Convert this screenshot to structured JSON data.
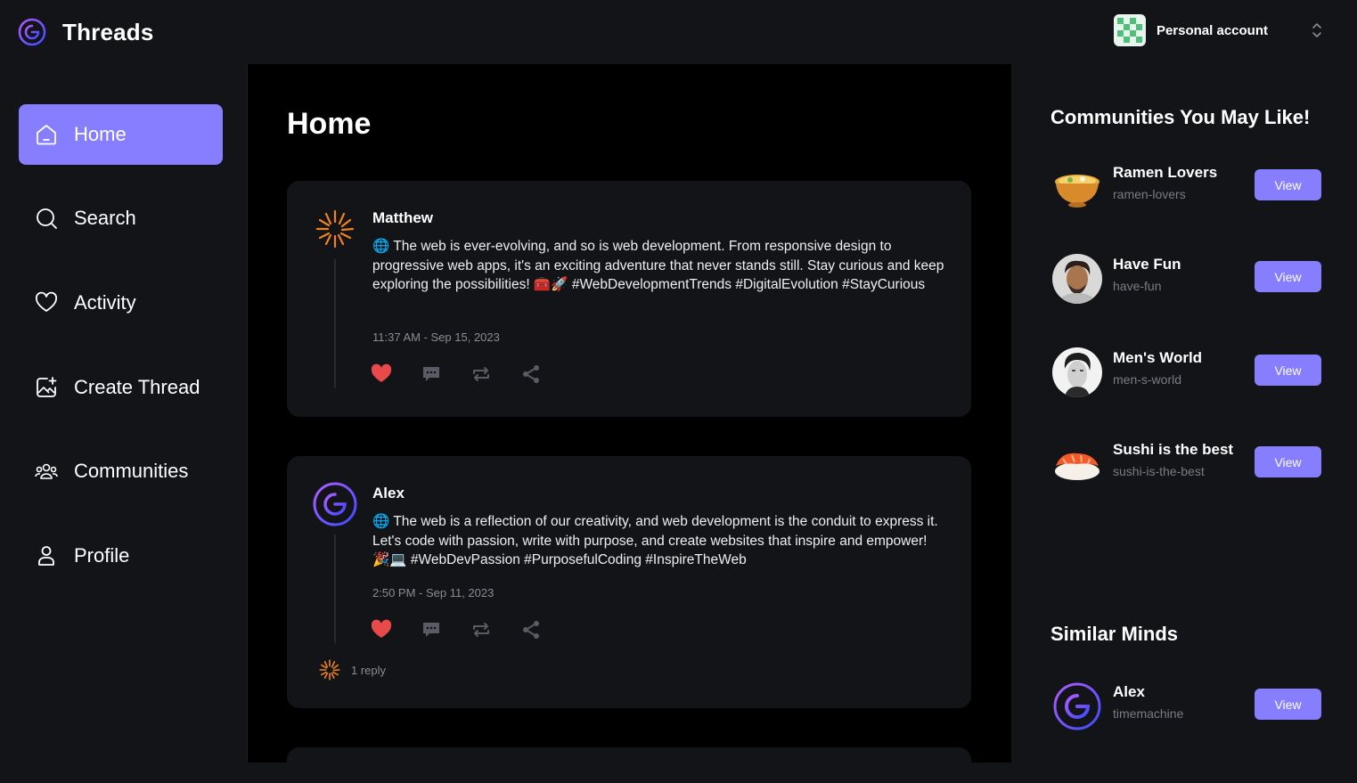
{
  "app": {
    "name": "Threads"
  },
  "account": {
    "label": "Personal account"
  },
  "nav": {
    "items": [
      {
        "label": "Home",
        "icon": "home-icon",
        "active": true
      },
      {
        "label": "Search",
        "icon": "search-icon"
      },
      {
        "label": "Activity",
        "icon": "heart-icon"
      },
      {
        "label": "Create Thread",
        "icon": "create-thread-icon"
      },
      {
        "label": "Communities",
        "icon": "communities-icon"
      },
      {
        "label": "Profile",
        "icon": "user-icon"
      }
    ]
  },
  "main": {
    "title": "Home",
    "threads": [
      {
        "author": "Matthew",
        "body": "🌐 The web is ever-evolving, and so is web development. From responsive design to progressive web apps, it's an exciting adventure that never stands still. Stay curious and keep exploring the possibilities! 🧰🚀 #WebDevelopmentTrends #DigitalEvolution #StayCurious",
        "timestamp": "11:37 AM - Sep 15, 2023",
        "liked": true
      },
      {
        "author": "Alex",
        "body": "🌐 The web is a reflection of our creativity, and web development is the conduit to express it. Let's code with passion, write with purpose, and create websites that inspire and empower! 🎉💻 #WebDevPassion #PurposefulCoding #InspireTheWeb",
        "timestamp": "2:50 PM - Sep 11, 2023",
        "liked": true,
        "replies": "1 reply"
      }
    ]
  },
  "communities": {
    "title": "Communities You May Like!",
    "items": [
      {
        "name": "Ramen Lovers",
        "handle": "ramen-lovers",
        "button": "View"
      },
      {
        "name": "Have Fun",
        "handle": "have-fun",
        "button": "View"
      },
      {
        "name": "Men's World",
        "handle": "men-s-world",
        "button": "View"
      },
      {
        "name": "Sushi is the best",
        "handle": "sushi-is-the-best",
        "button": "View"
      }
    ]
  },
  "similar": {
    "title": "Similar Minds",
    "items": [
      {
        "name": "Alex",
        "handle": "timemachine",
        "button": "View"
      }
    ]
  },
  "colors": {
    "accent": "#877eff",
    "like": "#e84a4a",
    "card": "#121417"
  }
}
